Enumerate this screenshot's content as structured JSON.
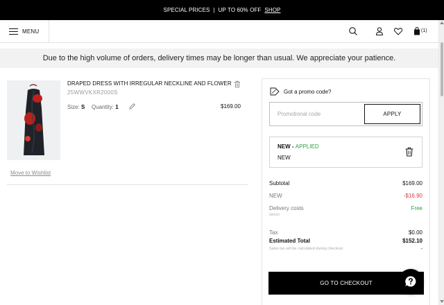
{
  "promo_bar": {
    "text": "SPECIAL PRICES",
    "separator": "|",
    "offer": "UP TO 60% OFF",
    "link": "SHOP"
  },
  "header": {
    "menu_label": "MENU",
    "cart_count": "(1)"
  },
  "notice": "Due to the high volume of orders, delivery times may be longer than usual. We appreciate your patience.",
  "cart_item": {
    "name": "DRAPED DRESS WITH IRREGULAR NECKLINE AND FLOWER",
    "ref": "25WWVKXR2000S",
    "size_label": "Size:",
    "size": "S",
    "quantity_label": "Quantity:",
    "quantity": "1",
    "price": "$169.00",
    "wishlist_link": "Move to Wishlist"
  },
  "summary": {
    "promo_question": "Got a promo code?",
    "promo_placeholder": "Promotional code",
    "apply_label": "APPLY",
    "applied": {
      "code": "NEW",
      "dash": " - ",
      "status": "APPLIED",
      "description": "NEW"
    },
    "subtotal_label": "Subtotal",
    "subtotal": "$169.00",
    "discount_label": "NEW",
    "discount": "-$16.90",
    "delivery_label": "Delivery costs",
    "delivery_value": "Free",
    "delivery_note": "(since)",
    "tax_label": "Tax",
    "tax": "$0.00",
    "total_label": "Estimated Total",
    "total": "$152.10",
    "tax_note": "Sales tax will be calculated during checkout",
    "tax_note_value": "-",
    "checkout_label": "GO TO CHECKOUT"
  },
  "colors": {
    "applied_green": "#2f9e44",
    "discount_red": "#d23c3c",
    "brand_black": "#000000"
  },
  "icons": [
    "hamburger-icon",
    "search-icon",
    "user-icon",
    "heart-icon",
    "bag-icon",
    "trash-icon",
    "pencil-icon",
    "promo-tag-icon",
    "help-icon"
  ]
}
